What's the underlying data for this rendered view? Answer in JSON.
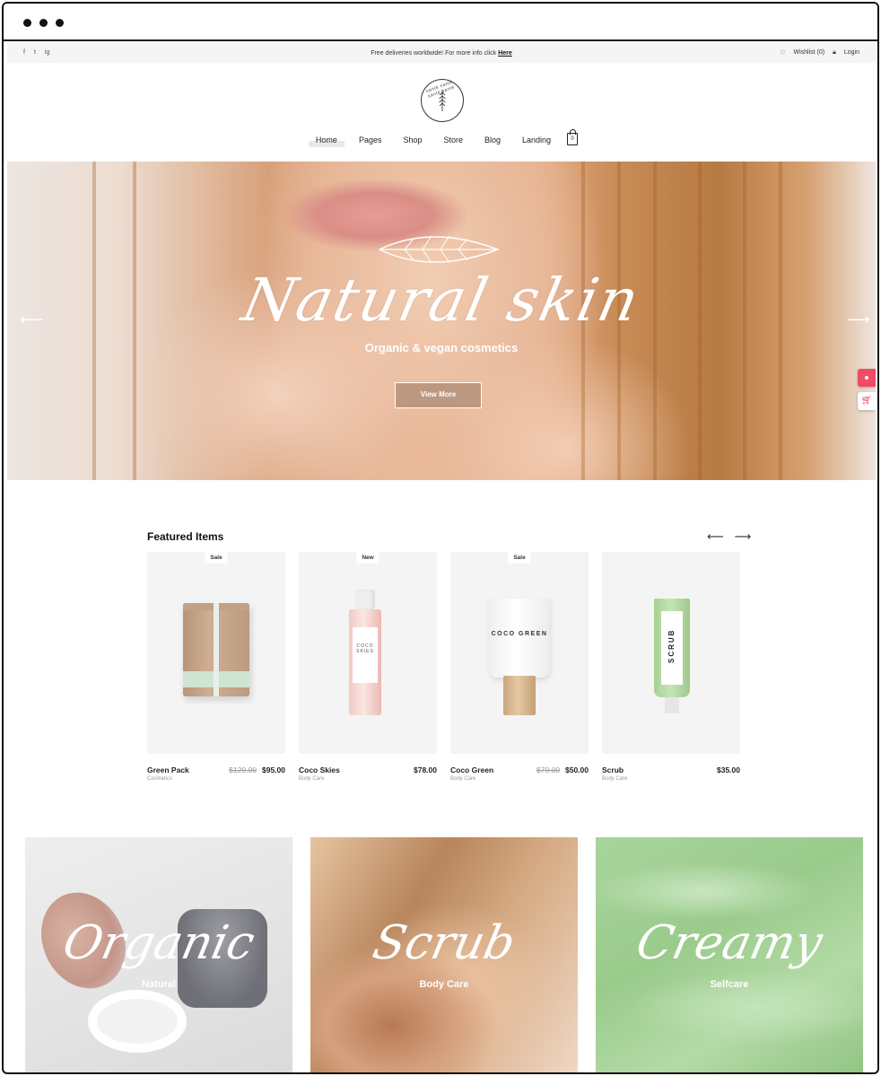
{
  "topbar": {
    "social": [
      "f",
      "t",
      "ig"
    ],
    "promo_text": "Free deliveries worldwide! For more info click",
    "promo_link": "Here",
    "wishlist": "Wishlist (0)",
    "login": "Login"
  },
  "logo": {
    "ring_text": "santé santé santé santé"
  },
  "nav": {
    "items": [
      "Home",
      "Pages",
      "Shop",
      "Store",
      "Blog",
      "Landing"
    ],
    "active": "Home",
    "cart_count": "0"
  },
  "hero": {
    "title": "Natural skin",
    "subtitle": "Organic & vegan cosmetics",
    "button": "View More"
  },
  "featured": {
    "title": "Featured Items",
    "items": [
      {
        "badge": "Sale",
        "name": "Green Pack",
        "category": "Cosmetics",
        "old_price": "$120.00",
        "price": "$95.00"
      },
      {
        "badge": "New",
        "name": "Coco Skies",
        "category": "Body Care",
        "old_price": "",
        "price": "$78.00",
        "label": "COCO SKIES"
      },
      {
        "badge": "Sale",
        "name": "Coco Green",
        "category": "Body Care",
        "old_price": "$70.00",
        "price": "$50.00",
        "label": "COCO GREEN"
      },
      {
        "badge": "",
        "name": "Scrub",
        "category": "Body Care",
        "old_price": "",
        "price": "$35.00",
        "label": "SCRUB"
      }
    ]
  },
  "categories": [
    {
      "script": "Organic",
      "label": "Natural"
    },
    {
      "script": "Scrub",
      "label": "Body Care"
    },
    {
      "script": "Creamy",
      "label": "Selfcare"
    }
  ],
  "colors": {
    "accent": "#f04a64",
    "sale_gray": "#999999"
  }
}
